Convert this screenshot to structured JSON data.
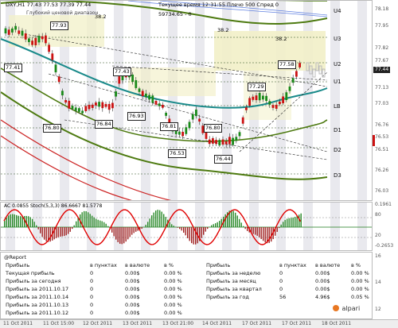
{
  "chart": {
    "symbol_line": "DXY,H1  77.43 77.53 77.39 77.44",
    "subtitle": "Глубокий ценовой диапазон",
    "server_time": "Текущее время 12:31:55 Плечо 500 Спред 0",
    "balance": "59734.65 - 0",
    "fib_top_left": "38.2",
    "fib_mid": "38.2",
    "fib_right": "38.2",
    "zones": [
      "U4",
      "U3",
      "U2",
      "U1",
      "LB",
      "D1",
      "D2",
      "D3"
    ],
    "price_badges": [
      "77.93",
      "77.41",
      "77.43",
      "76.80",
      "76.84",
      "76.93",
      "76.81",
      "76.80",
      "76.53",
      "76.44",
      "77.29",
      "77.58"
    ],
    "y_ticks": [
      "78.18",
      "77.95",
      "77.82",
      "77.67",
      "77.44",
      "77.13",
      "77.03",
      "76.76",
      "76.53",
      "76.51",
      "76.26",
      "76.03"
    ],
    "last_price": "77.44"
  },
  "oscillator": {
    "label": "AC 0.0855  Stoch(5,3,3) 86.6667 81.5778",
    "ticks": [
      "0.1961",
      "80",
      "20",
      "-0.2653"
    ]
  },
  "report": {
    "title": "@Report",
    "left_headers": [
      "Прибыль",
      "в пунктах",
      "в валюте",
      "в %"
    ],
    "left_rows": [
      [
        "Текущая прибыль",
        "0",
        "0.00$",
        "0.00 %"
      ],
      [
        "Прибыль за сегодня",
        "0",
        "0.00$",
        "0.00 %"
      ],
      [
        "Прибыль за 2011.10.17",
        "0",
        "0.00$",
        "0.00 %"
      ],
      [
        "Прибыль за 2011.10.14",
        "0",
        "0.00$",
        "0.00 %"
      ],
      [
        "Прибыль за 2011.10.13",
        "0",
        "0.00$",
        "0.00 %"
      ],
      [
        "Прибыль за 2011.10.12",
        "0",
        "0.00$",
        "0.00 %"
      ]
    ],
    "right_headers": [
      "Прибыль",
      "в пунктах",
      "в валюте",
      "в %"
    ],
    "right_rows": [
      [
        "Прибыль за неделю",
        "0",
        "0.00$",
        "0.00 %"
      ],
      [
        "Прибыль за месяц",
        "0",
        "0.00$",
        "0.00 %"
      ],
      [
        "Прибыль за квартал",
        "0",
        "0.00$",
        "0.00 %"
      ],
      [
        "Прибыль за год",
        "56",
        "4.96$",
        "0.05 %"
      ]
    ],
    "ticks": [
      "16",
      "14",
      "12"
    ]
  },
  "time_axis": [
    "11 Oct 2011",
    "11 Oct 15:00",
    "12 Oct 2011",
    "13 Oct 2011",
    "13 Oct 21:00",
    "14 Oct 2011",
    "17 Oct 2011",
    "17 Oct 2011",
    "18 Oct 2011"
  ],
  "brand": "alpari",
  "colors": {
    "candle_up": "#1a8a1a",
    "candle_down": "#cc1111",
    "channel_outer": "#4d7a10",
    "channel_mid": "#1a8a8a",
    "zone_fill": "#f2f0c8",
    "stoch": "#e00000"
  }
}
